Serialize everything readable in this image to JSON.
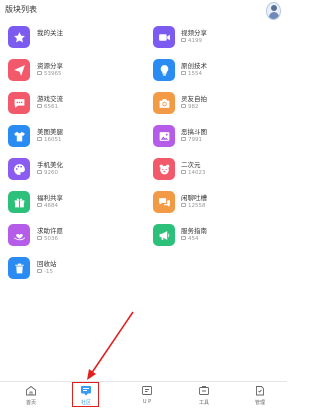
{
  "header": {
    "title": "版块列表"
  },
  "colors": {
    "accent": "#3a9cf0",
    "highlight": "#e0201e"
  },
  "boards": [
    {
      "name": "我的关注",
      "count": "",
      "icon": "star-icon",
      "color": "#7c5cf0"
    },
    {
      "name": "视频分享",
      "count": "4199",
      "icon": "video-icon",
      "color": "#7c5cf0"
    },
    {
      "name": "资源分享",
      "count": "53965",
      "icon": "send-icon",
      "color": "#f2596a"
    },
    {
      "name": "原创技术",
      "count": "1554",
      "icon": "bulb-icon",
      "color": "#2a8cf2"
    },
    {
      "name": "游戏交流",
      "count": "6561",
      "icon": "chat-icon",
      "color": "#f2596a"
    },
    {
      "name": "灵友自拍",
      "count": "982",
      "icon": "camera-icon",
      "color": "#f29a46"
    },
    {
      "name": "美图美腿",
      "count": "16051",
      "icon": "shirt-icon",
      "color": "#2a8cf2"
    },
    {
      "name": "恶搞斗图",
      "count": "7991",
      "icon": "image-icon",
      "color": "#b55ce8"
    },
    {
      "name": "手机美化",
      "count": "9260",
      "icon": "palette-icon",
      "color": "#8a5cf0"
    },
    {
      "name": "二次元",
      "count": "14023",
      "icon": "bear-icon",
      "color": "#f2596a"
    },
    {
      "name": "福利共享",
      "count": "4684",
      "icon": "gift-icon",
      "color": "#2cc07a"
    },
    {
      "name": "闲聊吐槽",
      "count": "12558",
      "icon": "talk-icon",
      "color": "#f29a46"
    },
    {
      "name": "求助许愿",
      "count": "5036",
      "icon": "hand-heart-icon",
      "color": "#b55ce8"
    },
    {
      "name": "服务指南",
      "count": "454",
      "icon": "megaphone-icon",
      "color": "#2cc07a"
    },
    {
      "name": "回收站",
      "count": "-15",
      "icon": "trash-icon",
      "color": "#2a8cf2"
    }
  ],
  "tabs": [
    {
      "label": "首页",
      "icon": "home-icon",
      "active": false
    },
    {
      "label": "社区",
      "icon": "community-icon",
      "active": true
    },
    {
      "label": "U P",
      "icon": "up-icon",
      "active": false
    },
    {
      "label": "工具",
      "icon": "tools-icon",
      "active": false
    },
    {
      "label": "管理",
      "icon": "manage-icon",
      "active": false
    }
  ]
}
